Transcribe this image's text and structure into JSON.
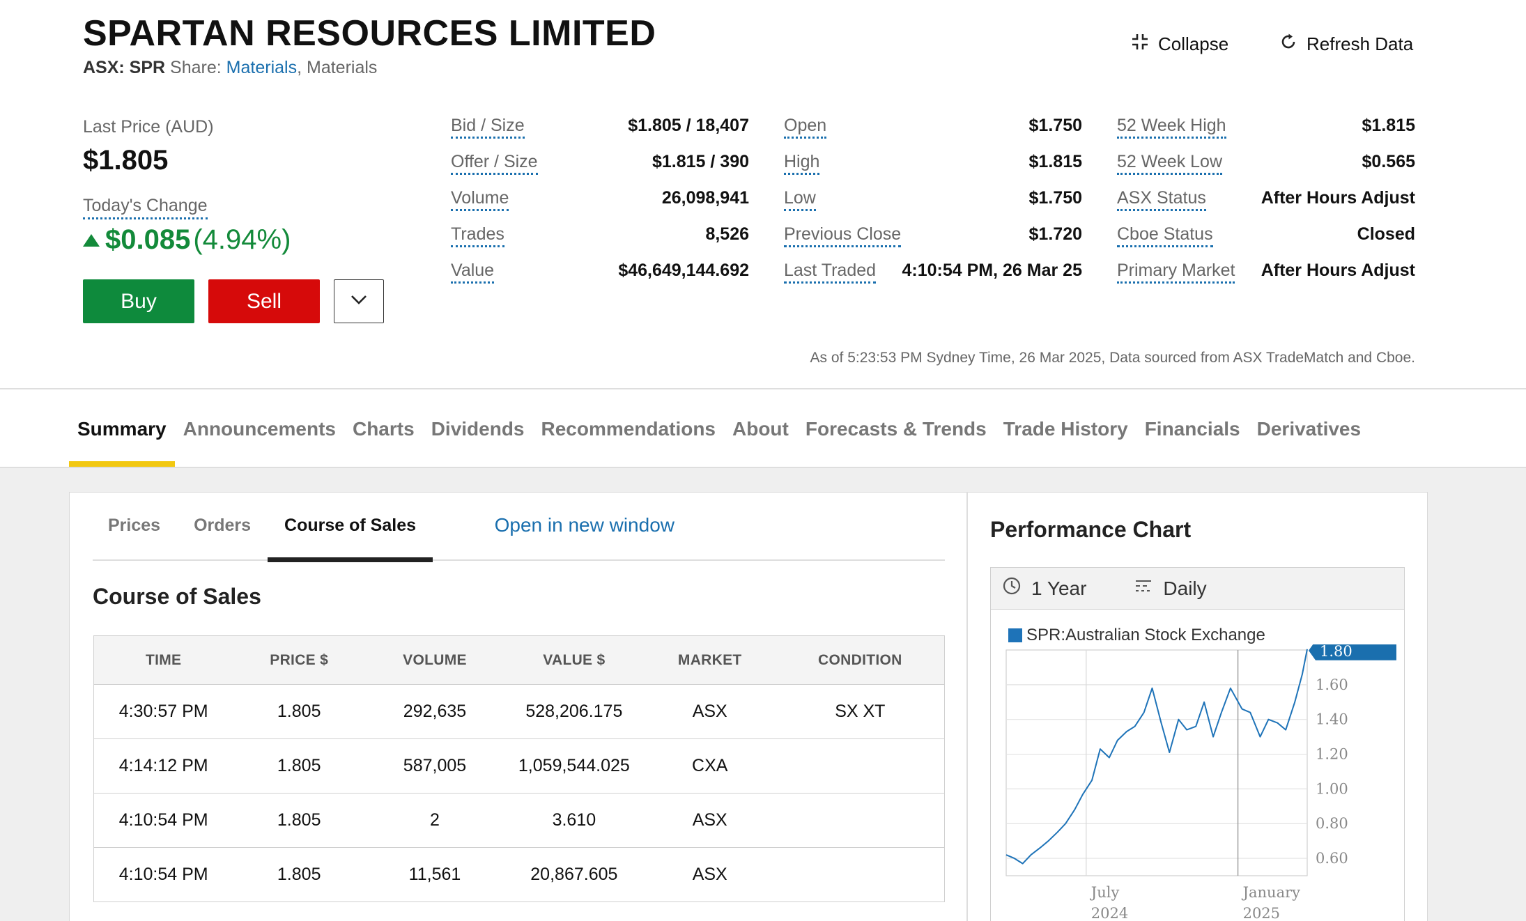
{
  "header": {
    "company": "SPARTAN RESOURCES LIMITED",
    "exchange_code": "ASX: SPR",
    "share_prefix": "Share:",
    "sector_link": "Materials",
    "sector_sep": ",",
    "sector_text": "Materials",
    "collapse_label": "Collapse",
    "refresh_label": "Refresh Data"
  },
  "quote": {
    "last_price_label": "Last Price (AUD)",
    "last_price": "$1.805",
    "todays_change_label": "Today's Change",
    "change_abs": "$0.085",
    "change_pct": "(4.94%)",
    "buy_label": "Buy",
    "sell_label": "Sell"
  },
  "stats": {
    "col1": [
      {
        "label": "Bid / Size",
        "value": "$1.805 / 18,407"
      },
      {
        "label": "Offer / Size",
        "value": "$1.815 / 390"
      },
      {
        "label": "Volume",
        "value": "26,098,941"
      },
      {
        "label": "Trades",
        "value": "8,526"
      },
      {
        "label": "Value",
        "value": "$46,649,144.692"
      }
    ],
    "col2": [
      {
        "label": "Open",
        "value": "$1.750"
      },
      {
        "label": "High",
        "value": "$1.815"
      },
      {
        "label": "Low",
        "value": "$1.750"
      },
      {
        "label": "Previous Close",
        "value": "$1.720"
      },
      {
        "label": "Last Traded",
        "value": "4:10:54 PM, 26 Mar 25"
      }
    ],
    "col3": [
      {
        "label": "52 Week High",
        "value": "$1.815"
      },
      {
        "label": "52 Week Low",
        "value": "$0.565"
      },
      {
        "label": "ASX Status",
        "value": "After Hours Adjust"
      },
      {
        "label": "Cboe Status",
        "value": "Closed"
      },
      {
        "label": "Primary Market",
        "value": "After Hours Adjust"
      }
    ]
  },
  "as_of": "As of 5:23:53 PM Sydney Time, 26 Mar 2025, Data sourced from ASX TradeMatch and Cboe.",
  "main_tabs": [
    "Summary",
    "Announcements",
    "Charts",
    "Dividends",
    "Recommendations",
    "About",
    "Forecasts & Trends",
    "Trade History",
    "Financials",
    "Derivatives"
  ],
  "sub_tabs": [
    "Prices",
    "Orders",
    "Course of Sales"
  ],
  "open_new_window": "Open in new window",
  "course_of_sales": {
    "heading": "Course of Sales",
    "columns": [
      "TIME",
      "PRICE $",
      "VOLUME",
      "VALUE $",
      "MARKET",
      "CONDITION"
    ],
    "rows": [
      [
        "4:30:57 PM",
        "1.805",
        "292,635",
        "528,206.175",
        "ASX",
        "SX XT"
      ],
      [
        "4:14:12 PM",
        "1.805",
        "587,005",
        "1,059,544.025",
        "CXA",
        ""
      ],
      [
        "4:10:54 PM",
        "1.805",
        "2",
        "3.610",
        "ASX",
        ""
      ],
      [
        "4:10:54 PM",
        "1.805",
        "11,561",
        "20,867.605",
        "ASX",
        ""
      ]
    ]
  },
  "performance": {
    "title": "Performance Chart",
    "period_label": "1 Year",
    "interval_label": "Daily",
    "legend": "SPR:Australian Stock Exchange",
    "current_value_label": "1.80",
    "y_ticks": [
      "1.60",
      "1.40",
      "1.20",
      "1.00",
      "0.80",
      "0.60"
    ],
    "x_ticks": [
      {
        "label": "July",
        "year": "2024"
      },
      {
        "label": "January",
        "year": "2025"
      }
    ],
    "colors": {
      "line": "#1e73b8",
      "marker": "#1a6fae"
    }
  },
  "chart_data": {
    "type": "line",
    "series": [
      {
        "name": "SPR:Australian Stock Exchange",
        "x": [
          "2024-03-26",
          "2024-04-05",
          "2024-04-15",
          "2024-04-25",
          "2024-05-06",
          "2024-05-16",
          "2024-05-27",
          "2024-06-06",
          "2024-06-17",
          "2024-06-27",
          "2024-07-08",
          "2024-07-18",
          "2024-07-29",
          "2024-08-08",
          "2024-08-19",
          "2024-08-29",
          "2024-09-09",
          "2024-09-19",
          "2024-09-30",
          "2024-10-10",
          "2024-10-21",
          "2024-10-31",
          "2024-11-11",
          "2024-11-21",
          "2024-12-02",
          "2024-12-12",
          "2024-12-23",
          "2025-01-06",
          "2025-01-16",
          "2025-01-28",
          "2025-02-07",
          "2025-02-18",
          "2025-02-28",
          "2025-03-11",
          "2025-03-20",
          "2025-03-26"
        ],
        "values": [
          0.62,
          0.6,
          0.57,
          0.62,
          0.66,
          0.7,
          0.75,
          0.8,
          0.88,
          0.97,
          1.05,
          1.23,
          1.18,
          1.28,
          1.33,
          1.36,
          1.44,
          1.58,
          1.38,
          1.21,
          1.4,
          1.34,
          1.36,
          1.5,
          1.3,
          1.44,
          1.58,
          1.46,
          1.44,
          1.3,
          1.4,
          1.38,
          1.34,
          1.5,
          1.66,
          1.805
        ]
      }
    ],
    "ylim": [
      0.5,
      1.8
    ],
    "y_ticks": [
      0.6,
      0.8,
      1.0,
      1.2,
      1.4,
      1.6
    ],
    "grid": true,
    "legend": "top-left"
  }
}
